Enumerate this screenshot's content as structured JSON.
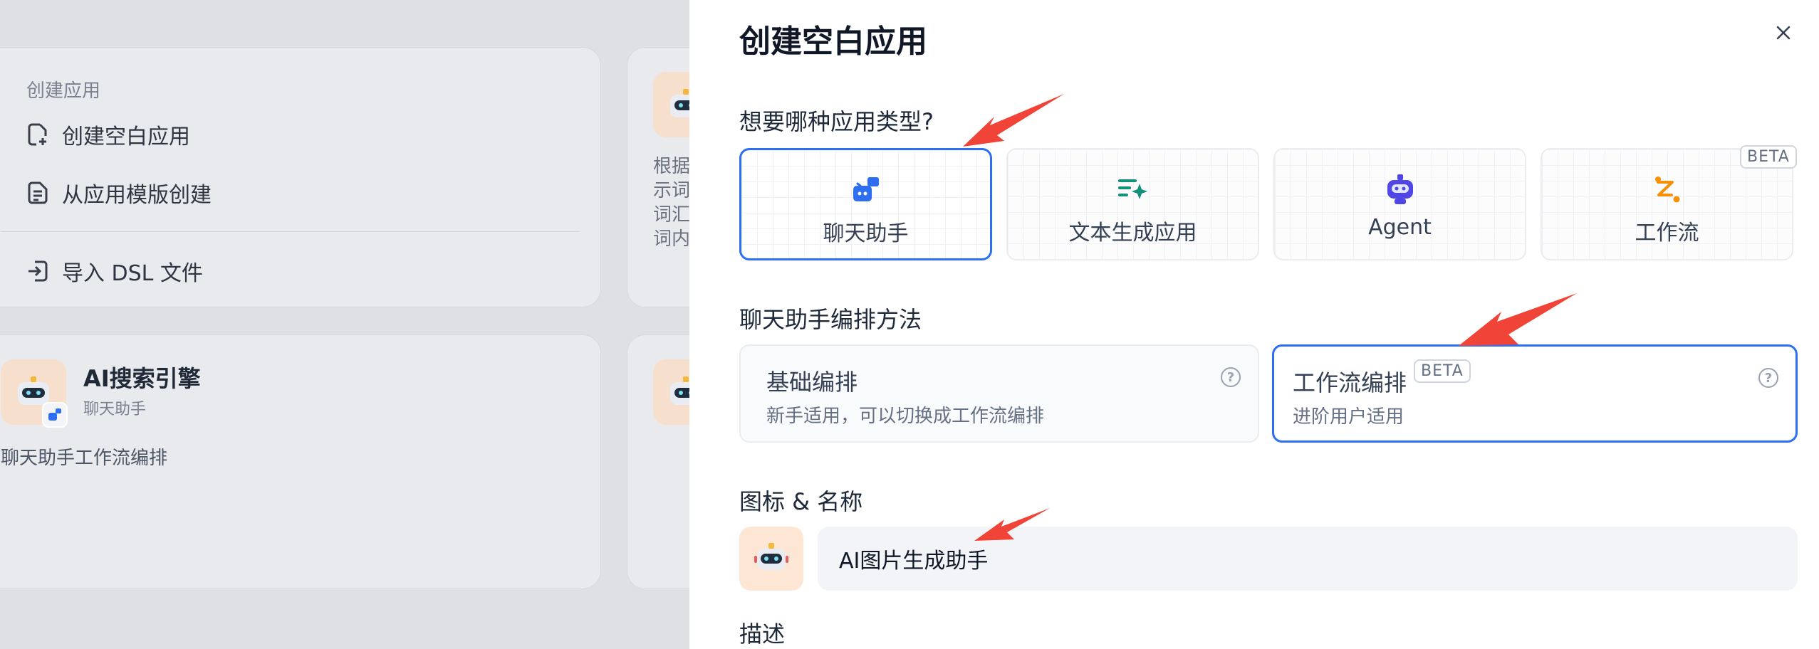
{
  "background": {
    "create_card": {
      "section_label": "创建应用",
      "items": [
        "创建空白应用",
        "从应用模版创建",
        "导入 DSL 文件"
      ]
    },
    "card2": {
      "truncated_lines": [
        "根据",
        "示词",
        "词汇",
        "词内"
      ]
    },
    "card3": {
      "title": "AI搜索引擎",
      "subtitle": "聊天助手",
      "description": "聊天助手工作流编排"
    }
  },
  "drawer": {
    "title": "创建空白应用",
    "app_type_question": "想要哪种应用类型?",
    "app_types": [
      {
        "label": "聊天助手",
        "icon": "chat-bot-icon",
        "selected": true
      },
      {
        "label": "文本生成应用",
        "icon": "text-generation-icon",
        "selected": false
      },
      {
        "label": "Agent",
        "icon": "robot-icon",
        "selected": false
      },
      {
        "label": "工作流",
        "icon": "workflow-icon",
        "selected": false,
        "badge": "BETA"
      }
    ],
    "orchestration_question": "聊天助手编排方法",
    "modes": [
      {
        "title": "基础编排",
        "subtitle": "新手适用，可以切换成工作流编排",
        "selected": false
      },
      {
        "title": "工作流编排",
        "badge": "BETA",
        "subtitle": "进阶用户适用",
        "selected": true
      }
    ],
    "icon_name_label": "图标 & 名称",
    "name_value": "AI图片生成助手",
    "description_label": "描述"
  },
  "colors": {
    "accent": "#2d6ff0",
    "arrow": "#f04438",
    "icon_bg": "#fde7d4"
  }
}
